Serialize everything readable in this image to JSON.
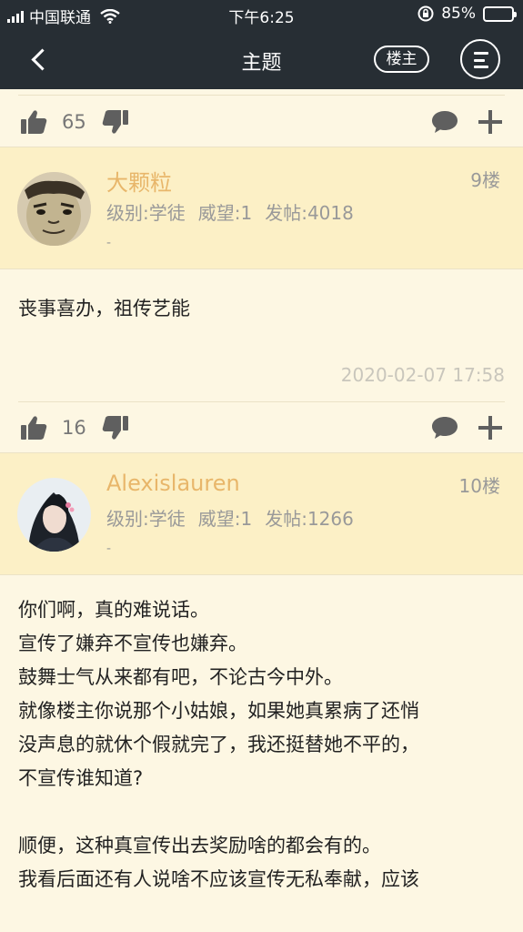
{
  "status_bar": {
    "carrier": "中国联通",
    "time": "下午6:25",
    "battery_text": "85%",
    "battery_level": 0.85
  },
  "nav": {
    "title": "主题",
    "owner_button": "楼主",
    "icons": [
      "back-arrow-icon",
      "menu-icon"
    ]
  },
  "prev_post": {
    "likes": "65"
  },
  "posts": [
    {
      "username": "大颗粒",
      "floor": "9楼",
      "level": "级别:学徒",
      "reputation": "威望:1",
      "post_count": "发帖:4018",
      "signature": "-",
      "content": [
        "丧事喜办，祖传艺能"
      ],
      "timestamp": "2020-02-07 17:58",
      "likes": "16"
    },
    {
      "username": "Alexislauren",
      "floor": "10楼",
      "level": "级别:学徒",
      "reputation": "威望:1",
      "post_count": "发帖:1266",
      "signature": "-",
      "content": [
        "你们啊，真的难说话。",
        "宣传了嫌弃不宣传也嫌弃。",
        "鼓舞士气从来都有吧，不论古今中外。",
        "就像楼主你说那个小姑娘，如果她真累病了还悄",
        "没声息的就休个假就完了，我还挺替她不平的，",
        "不宣传谁知道?",
        "",
        "顺便，这种真宣传出去奖励啥的都会有的。",
        "我看后面还有人说啥不应该宣传无私奉献，应该"
      ]
    }
  ],
  "colors": {
    "header_bg": "#272e34",
    "page_bg": "#fdf7e3",
    "post_header_bg": "#fcf0c6",
    "username": "#e8b66a",
    "meta_text": "#999999",
    "icon": "#5f5f5f"
  }
}
